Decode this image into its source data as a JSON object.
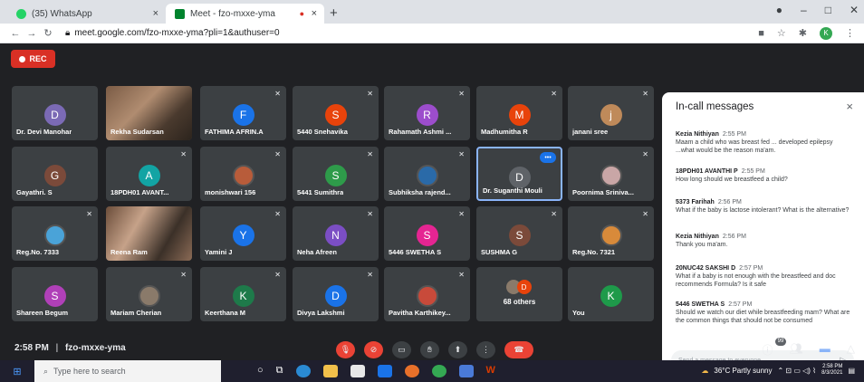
{
  "browser": {
    "tabs": [
      {
        "label": "(35) WhatsApp",
        "close": "×",
        "favicon_color": "#25d366"
      },
      {
        "label": "Meet - fzo-mxxe-yma",
        "close": "×",
        "favicon_color": "#00832d",
        "recording_dot": "●"
      }
    ],
    "new_tab": "+",
    "url": "meet.google.com/fzo-mxxe-yma?pli=1&authuser=0",
    "profile_initial": "K"
  },
  "meet": {
    "rec_label": "REC",
    "participants": [
      {
        "name": "Dr. Devi Manohar",
        "initial": "D",
        "color": "#7b6ab5"
      },
      {
        "name": "Rekha Sudarsan",
        "video": true
      },
      {
        "name": "FATHIMA AFRIN.A",
        "initial": "F",
        "color": "#1a73e8"
      },
      {
        "name": "5440 Snehavika",
        "initial": "S",
        "color": "#e8430b"
      },
      {
        "name": "Rahamath Ashmi ...",
        "initial": "R",
        "color": "#9c4dcc"
      },
      {
        "name": "Madhumitha R",
        "initial": "M",
        "color": "#e8430b"
      },
      {
        "name": "janani sree",
        "initial": "j",
        "color": "#bf8a5a"
      },
      {
        "name": "Gayathri. S",
        "initial": "G",
        "color": "#7b4a3a"
      },
      {
        "name": "18PDH01 AVANT...",
        "initial": "A",
        "color": "#12a4a4"
      },
      {
        "name": "monishwari 156",
        "photo": "#b85c3a"
      },
      {
        "name": "5441 Sumithra",
        "initial": "S",
        "color": "#2e9b4a"
      },
      {
        "name": "Subhiksha rajend...",
        "photo": "#2a6aa8"
      },
      {
        "name": "Dr. Suganthi Mouli",
        "initial": "D",
        "color": "#5f6368"
      },
      {
        "name": "Poornima Sriniva...",
        "photo": "#c9a6a6"
      },
      {
        "name": "Reg.No. 7333",
        "photo": "#4aa3d8"
      },
      {
        "name": "Reena Ram",
        "video": true
      },
      {
        "name": "Yamini J",
        "initial": "Y",
        "color": "#1a73e8"
      },
      {
        "name": "Neha Afreen",
        "initial": "N",
        "color": "#7b4ec4"
      },
      {
        "name": "5446 SWETHA S",
        "initial": "S",
        "color": "#e52592"
      },
      {
        "name": "SUSHMA G",
        "initial": "S",
        "color": "#7b4a3a"
      },
      {
        "name": "Reg.No. 7321",
        "photo": "#d88a3a"
      },
      {
        "name": "Shareen Begum",
        "initial": "S",
        "color": "#b040b8"
      },
      {
        "name": "Mariam Cherian",
        "photo": "#8a7a6a"
      },
      {
        "name": "Keerthana M",
        "initial": "K",
        "color": "#1e7a4a"
      },
      {
        "name": "Divya Lakshmi",
        "initial": "D",
        "color": "#1a73e8"
      },
      {
        "name": "Pavitha Karthikey...",
        "photo": "#c84a3a"
      },
      {
        "name": "68 others",
        "others": true
      },
      {
        "name": "You",
        "initial": "K",
        "color": "#1e9a4a"
      }
    ],
    "time": "2:58 PM",
    "meeting_code": "fzo-mxxe-yma",
    "separator": "|",
    "people_count": "99"
  },
  "chat": {
    "title": "In-call messages",
    "close": "×",
    "messages": [
      {
        "sender": "Kezia Nithiyan",
        "time": "2:55 PM",
        "text": "Maam a child who was breast fed ... developed epilepsy ...what would be the reason ma'am."
      },
      {
        "sender": "18PDH01 AVANTHI P",
        "time": "2:55 PM",
        "text": "How long should we breastfeed a child?"
      },
      {
        "sender": "5373 Farihah",
        "time": "2:56 PM",
        "text": "What if the baby is lactose intolerant? What is the alternative?"
      },
      {
        "sender": "Kezia Nithiyan",
        "time": "2:56 PM",
        "text": "Thank you ma'am."
      },
      {
        "sender": "20NUC42 SAKSHI D",
        "time": "2:57 PM",
        "text": "What if a baby is not enough with the breastfeed and doc recommends Formula? Is it safe"
      },
      {
        "sender": "5446 SWETHA S",
        "time": "2:57 PM",
        "text": "Should we watch our diet while breastfeeding mam? What are the common things that should not be consumed"
      }
    ],
    "send_placeholder": "Send a message to everyone"
  },
  "taskbar": {
    "search_placeholder": "Type here to search",
    "weather": "36°C  Partly sunny",
    "time": "2:58 PM",
    "date": "8/3/2021"
  }
}
